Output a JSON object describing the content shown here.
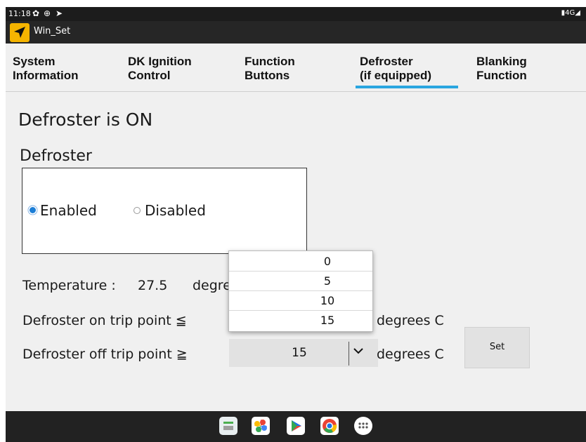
{
  "status_bar": {
    "time": "11:18",
    "icons": [
      "settings-icon",
      "vpn-icon",
      "location-icon"
    ],
    "right_text": "4G"
  },
  "app": {
    "title": "Win_Set",
    "icon": "navigation-arrow-icon",
    "icon_color": "#f5b400"
  },
  "tabs": [
    {
      "label": "System\nInformation"
    },
    {
      "label": "DK Ignition\nControl"
    },
    {
      "label": "Function\nButtons"
    },
    {
      "label": "Defroster\n(if equipped)",
      "selected": true
    },
    {
      "label": "Blanking\nFunction"
    }
  ],
  "accent_color": "#2aa6e0",
  "main": {
    "status": "Defroster is ON",
    "group_label": "Defroster",
    "radios": [
      {
        "label": "Enabled",
        "checked": true
      },
      {
        "label": "Disabled",
        "checked": false
      }
    ],
    "temperature_label": "Temperature :",
    "temperature_value": "27.5",
    "temperature_unit": "degrees C",
    "on_trip_label": "Defroster on trip point ≦",
    "on_trip_unit": "degrees C",
    "off_trip_label": "Defroster off trip point ≧",
    "off_trip_value": "15",
    "off_trip_unit": "degrees C",
    "set_button": "Set"
  },
  "dropdown_options": [
    "0",
    "5",
    "10",
    "15"
  ],
  "nav_bar": {
    "icons": [
      "calculator-icon",
      "pinwheel-photos-icon",
      "play-store-icon",
      "chrome-icon",
      "app-drawer-icon"
    ]
  }
}
